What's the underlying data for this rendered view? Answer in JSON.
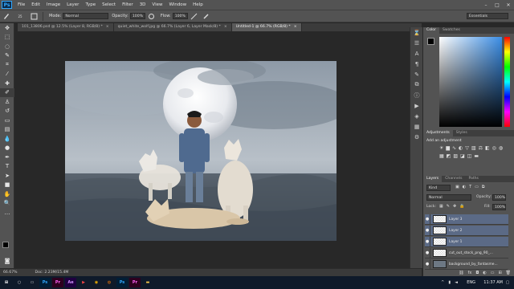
{
  "app": {
    "logo": "Ps"
  },
  "menu": [
    "File",
    "Edit",
    "Image",
    "Layer",
    "Type",
    "Select",
    "Filter",
    "3D",
    "View",
    "Window",
    "Help"
  ],
  "window_controls": [
    "–",
    "□",
    "✕"
  ],
  "options": {
    "brush_size": "25",
    "mode_label": "Mode:",
    "mode_value": "Normal",
    "opacity_label": "Opacity:",
    "opacity_value": "100%",
    "flow_label": "Flow:",
    "flow_value": "100%",
    "workspace": "Essentials"
  },
  "tabs": [
    {
      "label": "101_13806.psd @ 12.5% (Layer 8, RGB/8) *",
      "close": "×"
    },
    {
      "label": "quiet_white_wolf.jpg @ 66.7% (Layer 6, Layer Mask/8) *",
      "close": "×"
    },
    {
      "label": "Untitled-1 @ 66.7% (RGB/8) *",
      "close": "×"
    }
  ],
  "status": {
    "zoom": "66.67%",
    "doc": "Doc: 2.23M/15.4M"
  },
  "color_panel": {
    "tabs": [
      "Color",
      "Swatches"
    ],
    "accent": "#3b8ee6"
  },
  "adjustments_panel": {
    "tabs": [
      "Adjustments",
      "Styles"
    ],
    "hint": "Add an adjustment"
  },
  "layers_panel": {
    "tabs": [
      "Layers",
      "Channels",
      "Paths"
    ],
    "kind": "Kind",
    "blend": "Normal",
    "opacity_label": "Opacity:",
    "opacity": "100%",
    "lock_label": "Lock:",
    "fill_label": "Fill:",
    "fill": "100%",
    "layers": [
      {
        "name": "Layer 3",
        "selected": true,
        "eye": "●"
      },
      {
        "name": "Layer 2",
        "selected": true,
        "eye": "●"
      },
      {
        "name": "Layer 1",
        "selected": true,
        "eye": "●"
      },
      {
        "name": "cut_out_stock_png_90_...",
        "selected": false,
        "eye": "●"
      },
      {
        "name": "background_by_fantasme...",
        "selected": false,
        "eye": "●"
      }
    ]
  },
  "taskbar": {
    "lang": "ENG",
    "time": "11:37 AM",
    "date": ""
  }
}
